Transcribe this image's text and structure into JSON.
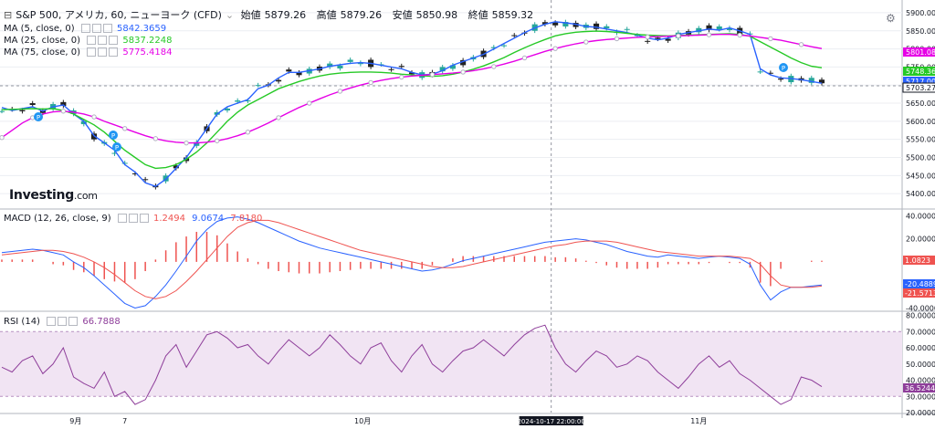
{
  "header": {
    "symbol_title": "S&P 500, アメリカ, 60, ニューヨーク (CFD)",
    "ohlc": [
      {
        "label": "始値",
        "value": "5879.26"
      },
      {
        "label": "高値",
        "value": "5879.26"
      },
      {
        "label": "安値",
        "value": "5850.98"
      },
      {
        "label": "終値",
        "value": "5859.32"
      }
    ]
  },
  "brand": {
    "name": "Investing",
    "suffix": ".com"
  },
  "colors": {
    "ma5": "#2962ff",
    "ma25": "#26c926",
    "ma75": "#e600e6",
    "macd_line": "#2962ff",
    "signal_line": "#ef5350",
    "hist": "#ef5350",
    "rsi": "#8e3e9a",
    "rsi_band": "#f1e4f3",
    "bull": "#26a69a",
    "bear": "#222222",
    "grid": "#eceef2"
  },
  "chart_data": [
    {
      "type": "line",
      "title": "S&P 500, アメリカ, 60, ニューヨーク (CFD)",
      "ylim": [
        5360,
        5920
      ],
      "y_ticks": [
        "5900.00",
        "5850.00",
        "5800.00",
        "5750.00",
        "5700.00",
        "5650.00",
        "5600.00",
        "5550.00",
        "5500.00",
        "5450.00",
        "5400.00"
      ],
      "x_ticks": [
        "9月",
        "7",
        "10月",
        "2024-10-17 22:00:00",
        "11月"
      ],
      "x_tick_pos": [
        0.09,
        0.15,
        0.44,
        0.67,
        0.85
      ],
      "series": [
        {
          "name": "MA (5, close, 0)",
          "last": "5842.3659",
          "values": [
            5638,
            5630,
            5635,
            5640,
            5628,
            5640,
            5645,
            5620,
            5600,
            5560,
            5540,
            5520,
            5480,
            5460,
            5430,
            5420,
            5440,
            5470,
            5500,
            5540,
            5580,
            5620,
            5640,
            5650,
            5660,
            5690,
            5700,
            5720,
            5735,
            5735,
            5740,
            5745,
            5752,
            5756,
            5760,
            5762,
            5760,
            5755,
            5750,
            5745,
            5735,
            5728,
            5730,
            5740,
            5755,
            5765,
            5775,
            5785,
            5800,
            5815,
            5830,
            5845,
            5858,
            5868,
            5875,
            5872,
            5868,
            5862,
            5860,
            5855,
            5850,
            5845,
            5838,
            5830,
            5825,
            5830,
            5840,
            5845,
            5850,
            5855,
            5852,
            5858,
            5850,
            5840,
            5745,
            5728,
            5720,
            5718,
            5715,
            5710,
            5705
          ]
        },
        {
          "name": "MA (25, close, 0)",
          "last": "5837.2248",
          "values": [
            5632,
            5633,
            5634,
            5635,
            5634,
            5635,
            5630,
            5620,
            5605,
            5590,
            5570,
            5545,
            5520,
            5500,
            5480,
            5470,
            5472,
            5480,
            5495,
            5515,
            5540,
            5570,
            5600,
            5625,
            5645,
            5660,
            5675,
            5690,
            5700,
            5710,
            5718,
            5725,
            5730,
            5733,
            5735,
            5736,
            5736,
            5735,
            5733,
            5730,
            5728,
            5726,
            5724,
            5726,
            5730,
            5736,
            5744,
            5753,
            5764,
            5776,
            5790,
            5803,
            5815,
            5826,
            5836,
            5842,
            5846,
            5848,
            5849,
            5848,
            5846,
            5843,
            5840,
            5838,
            5837,
            5836,
            5837,
            5838,
            5839,
            5840,
            5841,
            5842,
            5840,
            5835,
            5820,
            5805,
            5790,
            5775,
            5762,
            5752,
            5748
          ]
        },
        {
          "name": "MA (75, close, 0)",
          "last": "5775.4184",
          "values": [
            5555,
            5575,
            5595,
            5610,
            5620,
            5626,
            5628,
            5625,
            5620,
            5612,
            5600,
            5590,
            5580,
            5570,
            5560,
            5552,
            5546,
            5542,
            5540,
            5540,
            5542,
            5546,
            5552,
            5560,
            5570,
            5582,
            5595,
            5610,
            5624,
            5638,
            5650,
            5662,
            5673,
            5683,
            5692,
            5700,
            5707,
            5713,
            5718,
            5722,
            5725,
            5727,
            5729,
            5731,
            5733,
            5736,
            5740,
            5745,
            5751,
            5758,
            5766,
            5775,
            5784,
            5793,
            5801,
            5808,
            5814,
            5819,
            5823,
            5826,
            5828,
            5830,
            5832,
            5833,
            5834,
            5835,
            5836,
            5837,
            5838,
            5839,
            5840,
            5840,
            5838,
            5836,
            5832,
            5828,
            5824,
            5818,
            5812,
            5806,
            5801
          ]
        }
      ],
      "price_labels": [
        {
          "value": "5801.08",
          "color": "#e600e6"
        },
        {
          "value": "5748.36",
          "color": "#26c926"
        },
        {
          "value": "5717.00",
          "color": "#2962ff"
        },
        {
          "value": "5703.27",
          "color": "#131722"
        }
      ]
    },
    {
      "type": "line",
      "title": "MACD (12, 26, close, 9)",
      "ylim": [
        -42,
        45
      ],
      "y_ticks": [
        "40.0000",
        "20.0000",
        "-40.0000"
      ],
      "header_values": [
        "1.2494",
        "9.0674",
        "7.8180"
      ],
      "series": [
        {
          "name": "MACD",
          "values": [
            8,
            9,
            10,
            11,
            10,
            8,
            6,
            0,
            -5,
            -12,
            -20,
            -28,
            -36,
            -40,
            -38,
            -30,
            -20,
            -8,
            5,
            18,
            28,
            35,
            38,
            39,
            37,
            34,
            30,
            26,
            22,
            18,
            15,
            12,
            10,
            8,
            6,
            4,
            2,
            0,
            -2,
            -4,
            -6,
            -8,
            -7,
            -5,
            -2,
            1,
            3,
            5,
            7,
            9,
            11,
            13,
            15,
            17,
            18,
            19,
            20,
            19,
            17,
            15,
            12,
            9,
            7,
            5,
            4,
            6,
            5,
            4,
            3,
            4,
            5,
            4,
            3,
            -2,
            -20,
            -33,
            -26,
            -22,
            -22,
            -21,
            -20
          ]
        },
        {
          "name": "Signal",
          "values": [
            6,
            7,
            8,
            9,
            10,
            10,
            9,
            7,
            4,
            0,
            -5,
            -11,
            -18,
            -25,
            -30,
            -32,
            -30,
            -25,
            -17,
            -8,
            2,
            12,
            22,
            30,
            34,
            36,
            36,
            34,
            31,
            28,
            25,
            22,
            19,
            16,
            13,
            10,
            8,
            6,
            4,
            2,
            0,
            -2,
            -4,
            -5,
            -5,
            -4,
            -2,
            0,
            2,
            4,
            6,
            8,
            10,
            12,
            14,
            15,
            17,
            18,
            18,
            18,
            17,
            15,
            13,
            11,
            9,
            8,
            7,
            6,
            5,
            5,
            5,
            5,
            4,
            3,
            -2,
            -12,
            -20,
            -22,
            -22,
            -22,
            -21
          ]
        },
        {
          "name": "Histogram",
          "values": [
            2,
            2,
            2,
            2,
            0,
            -2,
            -3,
            -7,
            -9,
            -12,
            -15,
            -17,
            -18,
            -15,
            -8,
            2,
            10,
            17,
            22,
            26,
            26,
            23,
            16,
            9,
            3,
            -2,
            -6,
            -8,
            -9,
            -10,
            -10,
            -10,
            -9,
            -8,
            -7,
            -6,
            -6,
            -6,
            -6,
            -6,
            -6,
            -6,
            -3,
            0,
            3,
            5,
            5,
            5,
            5,
            5,
            5,
            5,
            5,
            5,
            4,
            4,
            3,
            1,
            -1,
            -3,
            -5,
            -6,
            -6,
            -6,
            -5,
            -2,
            -2,
            -2,
            -2,
            -1,
            0,
            -1,
            -1,
            -5,
            -18,
            -21,
            -6,
            0,
            0,
            1,
            1
          ]
        }
      ],
      "price_labels": [
        {
          "value": "1.0823",
          "color": "#ef5350"
        },
        {
          "value": "-20.4889",
          "color": "#2962ff"
        },
        {
          "value": "-21.5713",
          "color": "#ef5350"
        }
      ]
    },
    {
      "type": "line",
      "title": "RSI (14)",
      "ylim": [
        20,
        82
      ],
      "y_ticks": [
        "80.0000",
        "70.0000",
        "60.0000",
        "50.0000",
        "40.0000",
        "30.0000",
        "20.0000"
      ],
      "header_values": [
        "66.7888"
      ],
      "band": [
        30,
        70
      ],
      "series": [
        {
          "name": "RSI",
          "values": [
            48,
            45,
            52,
            55,
            44,
            50,
            60,
            42,
            38,
            35,
            45,
            30,
            33,
            25,
            28,
            40,
            55,
            62,
            48,
            58,
            68,
            70,
            66,
            60,
            62,
            55,
            50,
            58,
            65,
            60,
            55,
            60,
            68,
            62,
            55,
            50,
            60,
            63,
            52,
            45,
            55,
            62,
            50,
            45,
            52,
            58,
            60,
            65,
            60,
            55,
            62,
            68,
            72,
            74,
            60,
            50,
            45,
            52,
            58,
            55,
            48,
            50,
            55,
            52,
            45,
            40,
            35,
            42,
            50,
            55,
            48,
            52,
            44,
            40,
            35,
            30,
            25,
            28,
            42,
            40,
            36
          ]
        }
      ],
      "price_labels": [
        {
          "value": "36.5244",
          "color": "#8e3e9a"
        }
      ]
    }
  ]
}
